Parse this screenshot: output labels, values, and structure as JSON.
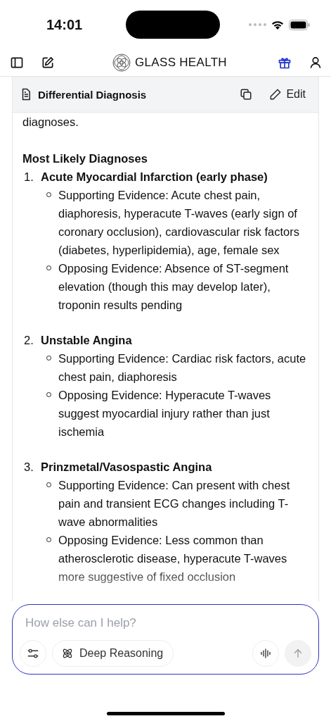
{
  "status_bar": {
    "time": "14:01"
  },
  "nav": {
    "brand": "GLASS HEALTH"
  },
  "card": {
    "title": "Differential Diagnosis",
    "edit_label": "Edit"
  },
  "content": {
    "intro": "diagnoses.",
    "section_title": "Most Likely Diagnoses",
    "diagnoses": [
      {
        "number": "1.",
        "title": "Acute Myocardial Infarction (early phase)",
        "points": [
          "Supporting Evidence: Acute chest pain, diaphoresis, hyperacute T-waves (early sign of coronary occlusion), cardiovascular risk factors (diabetes, hyperlipidemia), age, female sex",
          "Opposing Evidence: Absence of ST-segment elevation (though this may develop later), troponin results pending"
        ]
      },
      {
        "number": "2.",
        "title": "Unstable Angina",
        "points": [
          "Supporting Evidence: Cardiac risk factors, acute chest pain, diaphoresis",
          "Opposing Evidence: Hyperacute T-waves suggest myocardial injury rather than just ischemia"
        ]
      },
      {
        "number": "3.",
        "title": "Prinzmetal/Vasospastic Angina",
        "points": [
          "Supporting Evidence: Can present with chest pain and transient ECG changes including T-wave abnormalities",
          "Opposing Evidence: Less common than atherosclerotic disease, hyperacute T-waves more suggestive of fixed occlusion"
        ]
      }
    ]
  },
  "composer": {
    "placeholder": "How else can I help?",
    "mode_label": "Deep Reasoning"
  }
}
